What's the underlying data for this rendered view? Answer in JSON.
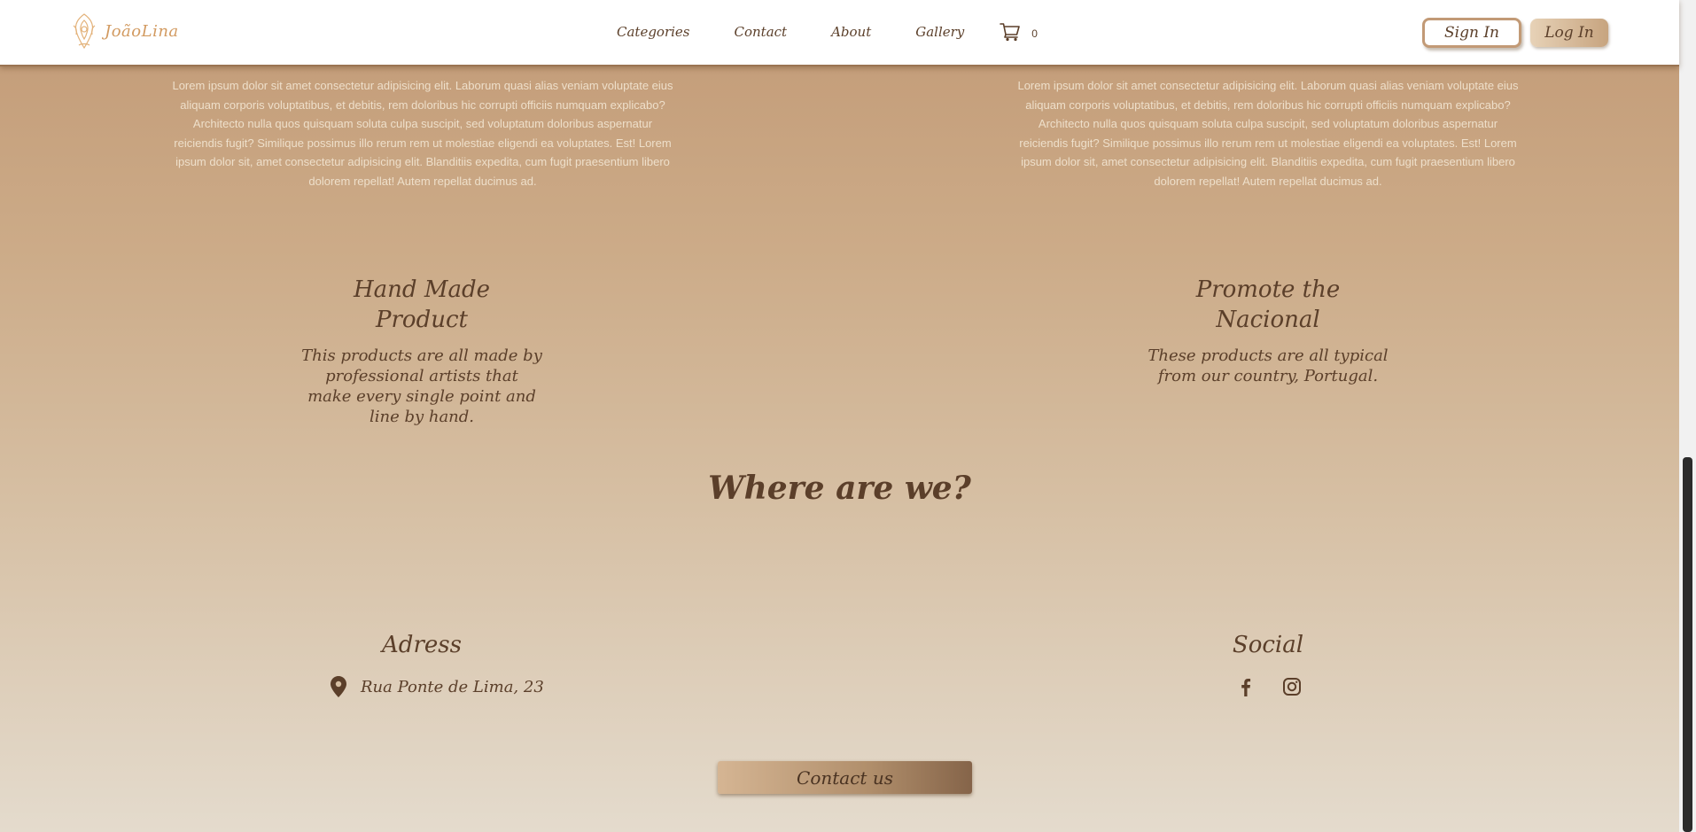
{
  "header": {
    "logo_text": "JoãoLina",
    "logo_icon": "ornamental-flower-logo",
    "nav": [
      {
        "label": "Categories"
      },
      {
        "label": "Contact"
      },
      {
        "label": "About"
      },
      {
        "label": "Gallery"
      }
    ],
    "cart": {
      "icon": "cart-icon",
      "count": "0"
    },
    "signin_label": "Sign In",
    "login_label": "Log In"
  },
  "intro": {
    "left_text": "Lorem ipsum dolor sit amet consectetur adipisicing elit. Laborum quasi alias veniam voluptate eius aliquam corporis voluptatibus, et debitis, rem doloribus hic corrupti officiis numquam explicabo? Architecto nulla quos quisquam soluta culpa suscipit, sed voluptatum doloribus aspernatur reiciendis fugit? Similique possimus illo rerum rem ut molestiae eligendi ea voluptates. Est! Lorem ipsum dolor sit, amet consectetur adipisicing elit. Blanditiis expedita, cum fugit praesentium libero dolorem repellat! Autem repellat ducimus ad.",
    "right_text": "Lorem ipsum dolor sit amet consectetur adipisicing elit. Laborum quasi alias veniam voluptate eius aliquam corporis voluptatibus, et debitis, rem doloribus hic corrupti officiis numquam explicabo? Architecto nulla quos quisquam soluta culpa suscipit, sed voluptatum doloribus aspernatur reiciendis fugit? Similique possimus illo rerum rem ut molestiae eligendi ea voluptates. Est! Lorem ipsum dolor sit, amet consectetur adipisicing elit. Blanditiis expedita, cum fugit praesentium libero dolorem repellat! Autem repellat ducimus ad."
  },
  "features": {
    "left": {
      "title": "Hand Made Product",
      "text": "This products are all made by professional artists that make every single point and line by hand."
    },
    "right": {
      "title": "Promote the Nacional",
      "text": "These products are all typical from our country, Portugal."
    }
  },
  "location": {
    "heading": "Where are we?",
    "address_title": "Adress",
    "address_icon": "map-pin-icon",
    "address": "Rua Ponte de Lima, 23",
    "social_title": "Social",
    "social_icons": [
      "facebook-icon",
      "instagram-icon"
    ]
  },
  "contact_label": "Contact us",
  "colors": {
    "brand_brown": "#5b3f2a",
    "accent_tan": "#c29a76",
    "logo_gold": "#d29a60"
  }
}
